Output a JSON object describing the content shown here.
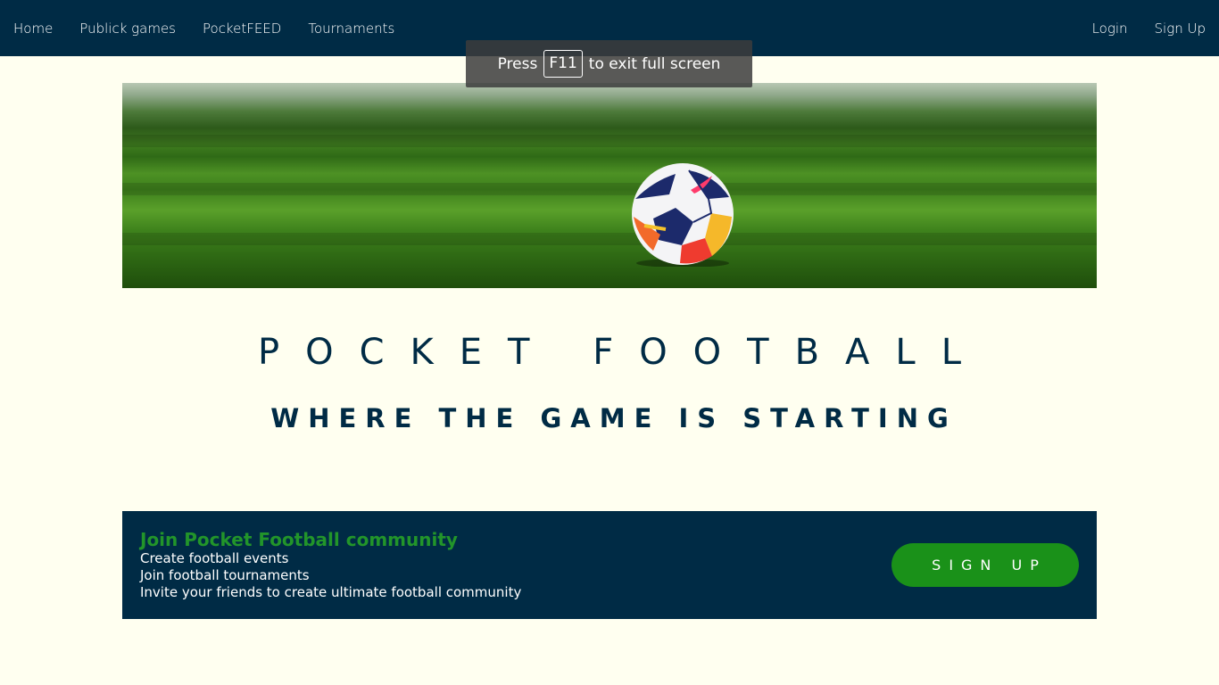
{
  "nav": {
    "left": [
      "Home",
      "Publick games",
      "PocketFEED",
      "Tournaments"
    ],
    "right": [
      "Login",
      "Sign Up"
    ]
  },
  "fullscreen_toast": {
    "prefix": "Press",
    "key": "F11",
    "suffix": "to exit full screen"
  },
  "hero": {
    "image": "football-on-grass"
  },
  "title": {
    "main": "POCKET FOOTBALL",
    "sub": "WHERE THE GAME IS STARTING"
  },
  "cta": {
    "heading": "Join Pocket Football community",
    "lines": [
      "Create football events",
      "Join football tournaments",
      "Invite your friends to create ultimate football community"
    ],
    "button": "SIGN UP"
  },
  "colors": {
    "navy": "#002b45",
    "background": "#fffff0",
    "green": "#1a9119",
    "heading_green": "#22952a"
  }
}
